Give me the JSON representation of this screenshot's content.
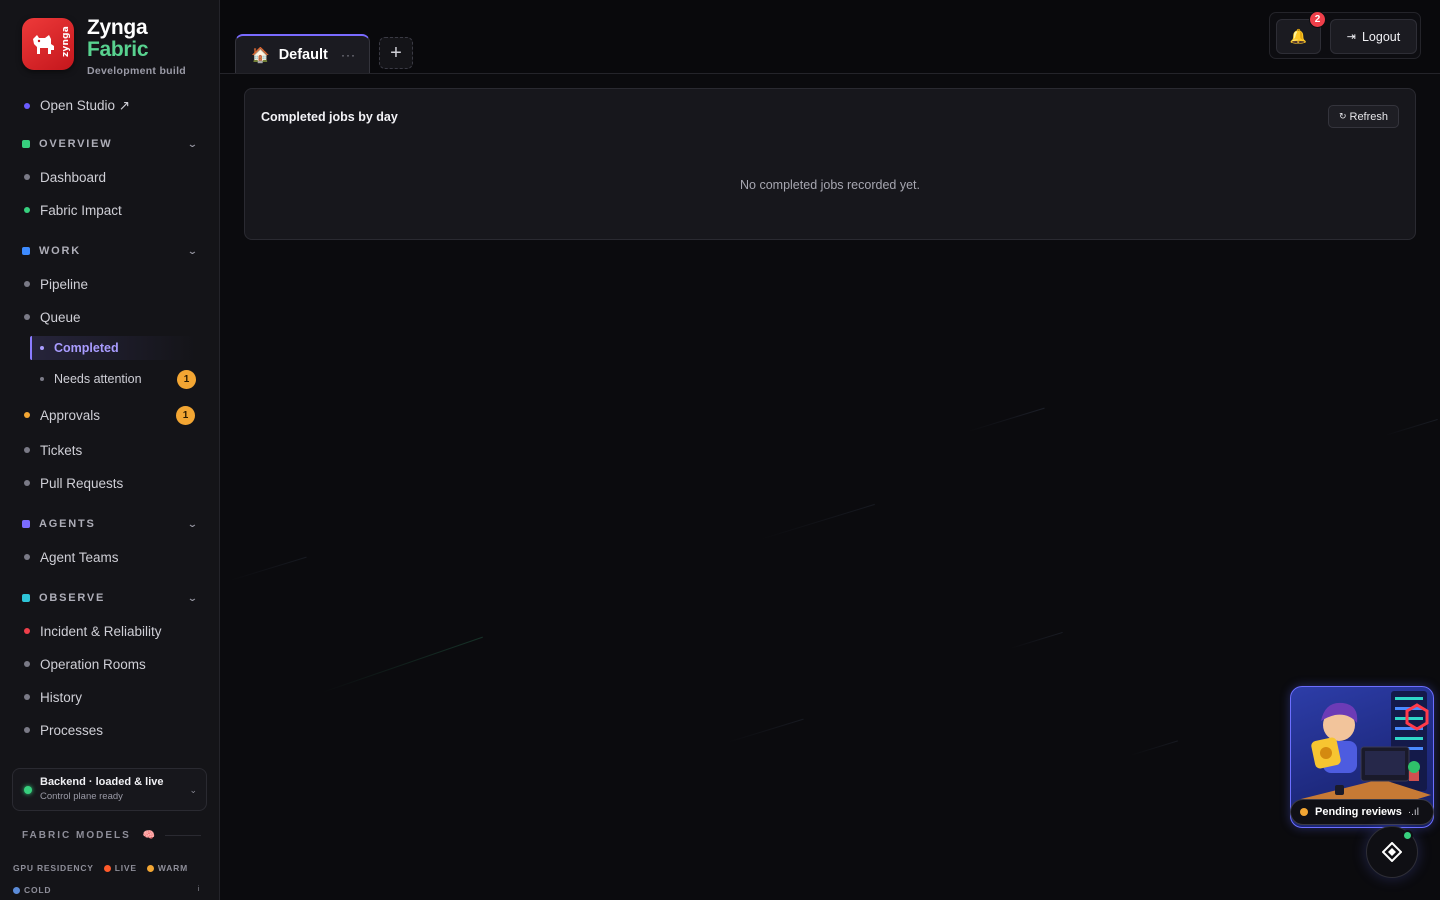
{
  "brand": {
    "name": "Zynga",
    "product": "Fabric",
    "build": "Development build",
    "logo_text": "zynga"
  },
  "sidebar": {
    "open_studio": "Open Studio ↗",
    "sections": {
      "overview": "OVERVIEW",
      "work": "WORK",
      "agents": "AGENTS",
      "observe": "OBSERVE"
    },
    "items": {
      "dashboard": "Dashboard",
      "fabric_impact": "Fabric Impact",
      "pipeline": "Pipeline",
      "queue": "Queue",
      "completed": "Completed",
      "needs_attention": "Needs attention",
      "needs_attention_count": "1",
      "approvals": "Approvals",
      "approvals_count": "1",
      "tickets": "Tickets",
      "pull_requests": "Pull Requests",
      "agent_teams": "Agent Teams",
      "incident": "Incident & Reliability",
      "operation_rooms": "Operation Rooms",
      "history": "History",
      "processes": "Processes"
    },
    "backend": {
      "status": "Backend · loaded & live",
      "detail": "Control plane ready"
    },
    "models": {
      "heading": "FABRIC MODELS",
      "gpu_label": "GPU RESIDENCY",
      "live": "LIVE",
      "warm": "WARM",
      "cold": "COLD"
    }
  },
  "tabs": {
    "default_label": "Default",
    "more": "···",
    "add": "+"
  },
  "header": {
    "notifications_count": "2",
    "logout_label": "Logout"
  },
  "panel": {
    "title": "Completed jobs by day",
    "refresh_label": "Refresh",
    "empty_message": "No completed jobs recorded yet."
  },
  "widget": {
    "pending_label": "Pending reviews",
    "more": "·.ıl"
  },
  "colors": {
    "accent": "#7a6bff",
    "brand_green": "#58d28f",
    "badge_orange": "#f3a633",
    "alert_red": "#ef3f4a",
    "live_green": "#37d07e"
  }
}
